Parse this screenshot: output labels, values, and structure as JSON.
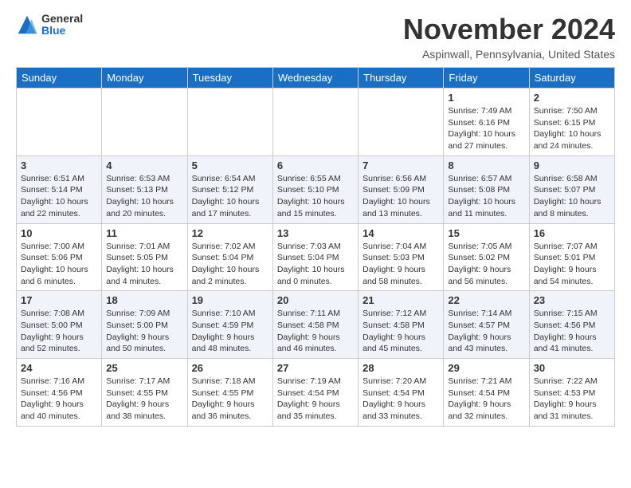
{
  "logo": {
    "general": "General",
    "blue": "Blue"
  },
  "header": {
    "month_title": "November 2024",
    "location": "Aspinwall, Pennsylvania, United States"
  },
  "weekdays": [
    "Sunday",
    "Monday",
    "Tuesday",
    "Wednesday",
    "Thursday",
    "Friday",
    "Saturday"
  ],
  "weeks": [
    [
      {
        "day": "",
        "info": ""
      },
      {
        "day": "",
        "info": ""
      },
      {
        "day": "",
        "info": ""
      },
      {
        "day": "",
        "info": ""
      },
      {
        "day": "",
        "info": ""
      },
      {
        "day": "1",
        "info": "Sunrise: 7:49 AM\nSunset: 6:16 PM\nDaylight: 10 hours and 27 minutes."
      },
      {
        "day": "2",
        "info": "Sunrise: 7:50 AM\nSunset: 6:15 PM\nDaylight: 10 hours and 24 minutes."
      }
    ],
    [
      {
        "day": "3",
        "info": "Sunrise: 6:51 AM\nSunset: 5:14 PM\nDaylight: 10 hours and 22 minutes."
      },
      {
        "day": "4",
        "info": "Sunrise: 6:53 AM\nSunset: 5:13 PM\nDaylight: 10 hours and 20 minutes."
      },
      {
        "day": "5",
        "info": "Sunrise: 6:54 AM\nSunset: 5:12 PM\nDaylight: 10 hours and 17 minutes."
      },
      {
        "day": "6",
        "info": "Sunrise: 6:55 AM\nSunset: 5:10 PM\nDaylight: 10 hours and 15 minutes."
      },
      {
        "day": "7",
        "info": "Sunrise: 6:56 AM\nSunset: 5:09 PM\nDaylight: 10 hours and 13 minutes."
      },
      {
        "day": "8",
        "info": "Sunrise: 6:57 AM\nSunset: 5:08 PM\nDaylight: 10 hours and 11 minutes."
      },
      {
        "day": "9",
        "info": "Sunrise: 6:58 AM\nSunset: 5:07 PM\nDaylight: 10 hours and 8 minutes."
      }
    ],
    [
      {
        "day": "10",
        "info": "Sunrise: 7:00 AM\nSunset: 5:06 PM\nDaylight: 10 hours and 6 minutes."
      },
      {
        "day": "11",
        "info": "Sunrise: 7:01 AM\nSunset: 5:05 PM\nDaylight: 10 hours and 4 minutes."
      },
      {
        "day": "12",
        "info": "Sunrise: 7:02 AM\nSunset: 5:04 PM\nDaylight: 10 hours and 2 minutes."
      },
      {
        "day": "13",
        "info": "Sunrise: 7:03 AM\nSunset: 5:04 PM\nDaylight: 10 hours and 0 minutes."
      },
      {
        "day": "14",
        "info": "Sunrise: 7:04 AM\nSunset: 5:03 PM\nDaylight: 9 hours and 58 minutes."
      },
      {
        "day": "15",
        "info": "Sunrise: 7:05 AM\nSunset: 5:02 PM\nDaylight: 9 hours and 56 minutes."
      },
      {
        "day": "16",
        "info": "Sunrise: 7:07 AM\nSunset: 5:01 PM\nDaylight: 9 hours and 54 minutes."
      }
    ],
    [
      {
        "day": "17",
        "info": "Sunrise: 7:08 AM\nSunset: 5:00 PM\nDaylight: 9 hours and 52 minutes."
      },
      {
        "day": "18",
        "info": "Sunrise: 7:09 AM\nSunset: 5:00 PM\nDaylight: 9 hours and 50 minutes."
      },
      {
        "day": "19",
        "info": "Sunrise: 7:10 AM\nSunset: 4:59 PM\nDaylight: 9 hours and 48 minutes."
      },
      {
        "day": "20",
        "info": "Sunrise: 7:11 AM\nSunset: 4:58 PM\nDaylight: 9 hours and 46 minutes."
      },
      {
        "day": "21",
        "info": "Sunrise: 7:12 AM\nSunset: 4:58 PM\nDaylight: 9 hours and 45 minutes."
      },
      {
        "day": "22",
        "info": "Sunrise: 7:14 AM\nSunset: 4:57 PM\nDaylight: 9 hours and 43 minutes."
      },
      {
        "day": "23",
        "info": "Sunrise: 7:15 AM\nSunset: 4:56 PM\nDaylight: 9 hours and 41 minutes."
      }
    ],
    [
      {
        "day": "24",
        "info": "Sunrise: 7:16 AM\nSunset: 4:56 PM\nDaylight: 9 hours and 40 minutes."
      },
      {
        "day": "25",
        "info": "Sunrise: 7:17 AM\nSunset: 4:55 PM\nDaylight: 9 hours and 38 minutes."
      },
      {
        "day": "26",
        "info": "Sunrise: 7:18 AM\nSunset: 4:55 PM\nDaylight: 9 hours and 36 minutes."
      },
      {
        "day": "27",
        "info": "Sunrise: 7:19 AM\nSunset: 4:54 PM\nDaylight: 9 hours and 35 minutes."
      },
      {
        "day": "28",
        "info": "Sunrise: 7:20 AM\nSunset: 4:54 PM\nDaylight: 9 hours and 33 minutes."
      },
      {
        "day": "29",
        "info": "Sunrise: 7:21 AM\nSunset: 4:54 PM\nDaylight: 9 hours and 32 minutes."
      },
      {
        "day": "30",
        "info": "Sunrise: 7:22 AM\nSunset: 4:53 PM\nDaylight: 9 hours and 31 minutes."
      }
    ]
  ]
}
